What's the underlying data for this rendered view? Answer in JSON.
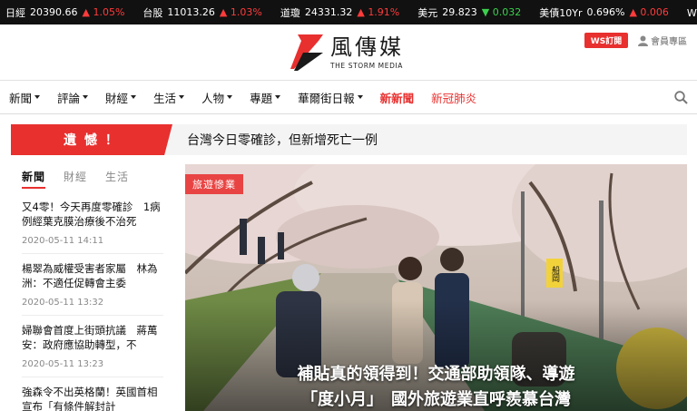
{
  "ticker": [
    {
      "name": "日經",
      "value": "20390.66",
      "dir": "up",
      "change": "1.05%"
    },
    {
      "name": "台股",
      "value": "11013.26",
      "dir": "up",
      "change": "1.03%"
    },
    {
      "name": "道瓊",
      "value": "24331.32",
      "dir": "up",
      "change": "1.91%"
    },
    {
      "name": "美元",
      "value": "29.823",
      "dir": "down",
      "change": "0.032"
    },
    {
      "name": "美債10Yr",
      "value": "0.696%",
      "dir": "up",
      "change": "0.006"
    },
    {
      "name": "WTI原",
      "value": "",
      "dir": "",
      "change": ""
    }
  ],
  "arrows": {
    "up": "▲",
    "down": "▼"
  },
  "header": {
    "logo_cn": "風傳媒",
    "logo_en": "THE STORM MEDIA",
    "ws_button": "WS訂閱",
    "member": "會員專區"
  },
  "nav": {
    "items": [
      "新聞",
      "評論",
      "財經",
      "生活",
      "人物",
      "專題",
      "華爾街日報"
    ],
    "special": [
      "新新聞",
      "新冠肺炎"
    ]
  },
  "breaking": {
    "tag": "遺 憾 ！",
    "text": "台灣今日零確診，但新增死亡一例"
  },
  "side": {
    "tabs": [
      "新聞",
      "財經",
      "生活"
    ],
    "items": [
      {
        "title": "又4零！今天再度零確診　1病例經葉克膜治療後不治死",
        "date": "2020-05-11 14:11"
      },
      {
        "title": "楊翠為威權受害者家屬　林為洲：不適任促轉會主委",
        "date": "2020-05-11 13:32"
      },
      {
        "title": "婦聯會首度上街頭抗議　蔣萬安：政府應協助轉型，不",
        "date": "2020-05-11 13:23"
      },
      {
        "title": "強森令不出英格蘭！英國首相宣布「有條件解封計",
        "date": ""
      }
    ]
  },
  "hero": {
    "category": "旅遊慘業",
    "title_line1": "補貼真的領得到！交通部助領隊、導遊",
    "title_line2": "「度小月」　國外旅遊業直呼羨慕台灣",
    "sign_text": "船岡"
  },
  "colors": {
    "brand_red": "#e8302f",
    "up": "#ff3b3b",
    "down": "#3ccf4e"
  }
}
